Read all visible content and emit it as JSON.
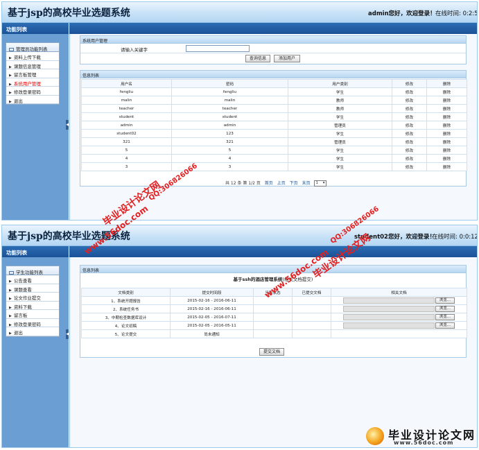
{
  "screen1": {
    "app_title": "基于jsp的高校毕业选题系统",
    "welcome": "admin您好，欢迎登录！",
    "online": "在线时间: 0:2:5",
    "sidebar_title": "功能列表",
    "menu_header": "管理员功能列表",
    "menu_items": [
      "资料上传下载",
      "课题信息管理",
      "留言板管理",
      "系统用户管理",
      "修改登录密码",
      "退出"
    ],
    "active_item": "系统用户管理",
    "search_panel": {
      "title": "系统用户管理",
      "keyword_label": "请输入关键字",
      "keyword_value": "",
      "query_button": "查询信息",
      "add_button": "添加用户"
    },
    "list_panel": {
      "title": "信息列表",
      "columns": [
        "用户名",
        "密码",
        "用户类别",
        "修改",
        "删除"
      ],
      "rows": [
        [
          "fengliu",
          "fengliu",
          "学生",
          "修改",
          "删除"
        ],
        [
          "malin",
          "malin",
          "教师",
          "修改",
          "删除"
        ],
        [
          "teacher",
          "teacher",
          "教师",
          "修改",
          "删除"
        ],
        [
          "student",
          "student",
          "学生",
          "修改",
          "删除"
        ],
        [
          "admin",
          "admin",
          "管理员",
          "修改",
          "删除"
        ],
        [
          "student02",
          "123",
          "学生",
          "修改",
          "删除"
        ],
        [
          "321",
          "321",
          "管理员",
          "修改",
          "删除"
        ],
        [
          "5",
          "5",
          "学生",
          "修改",
          "删除"
        ],
        [
          "4",
          "4",
          "学生",
          "修改",
          "删除"
        ],
        [
          "3",
          "3",
          "学生",
          "修改",
          "删除"
        ]
      ],
      "pager": {
        "summary": "共 12 条 第 1/2 页",
        "first": "首页",
        "prev": "上页",
        "next": "下页",
        "last": "末页",
        "page_select": "1"
      }
    }
  },
  "screen2": {
    "app_title": "基于jsp的高校毕业选题系统",
    "welcome": "student02您好，欢迎登录！",
    "online": "在线时间: 0:0:12",
    "sidebar_title": "功能列表",
    "menu_header": "学生功能列表",
    "menu_items": [
      "公告查看",
      "课题查看",
      "论文作业提交",
      "资料下载",
      "留言板",
      "修改登录密码",
      "退出"
    ],
    "panel": {
      "title": "信息列表",
      "subtitle_bold": "基于ssh的酒店管理系统",
      "subtitle_note": "(相关文档提交)",
      "columns": [
        "文档类别",
        "提交时间段",
        "当前状态",
        "已提交文档",
        "相关文档"
      ],
      "rows": [
        [
          "1、系统开题报告",
          "2015-02-16 - 2016-06-11",
          "",
          "",
          "浏览..."
        ],
        [
          "2、系统任务书",
          "2015-02-16 - 2016-06-11",
          "",
          "",
          "浏览..."
        ],
        [
          "3、中期检查数据库设计",
          "2015-02-05 - 2016-07-11",
          "",
          "",
          "浏览..."
        ],
        [
          "4、论文初稿",
          "2015-02-05 - 2016-05-11",
          "",
          "",
          "浏览..."
        ],
        [
          "5、论文提交",
          "尚未通知",
          "",
          "",
          ""
        ]
      ],
      "submit_button": "提交文档"
    }
  },
  "watermarks": {
    "site": "www.56doc.com",
    "brand": "毕业设计论文网",
    "qq": "QQ:306826066"
  },
  "logo": {
    "text": "毕业设计论文网",
    "url": "www.56doc.com"
  },
  "colors": {
    "header_blue": "#1b5297",
    "sidebar_blue": "#6b9ed3",
    "watermark_red": "#e32020",
    "active_menu": "#e00000"
  }
}
